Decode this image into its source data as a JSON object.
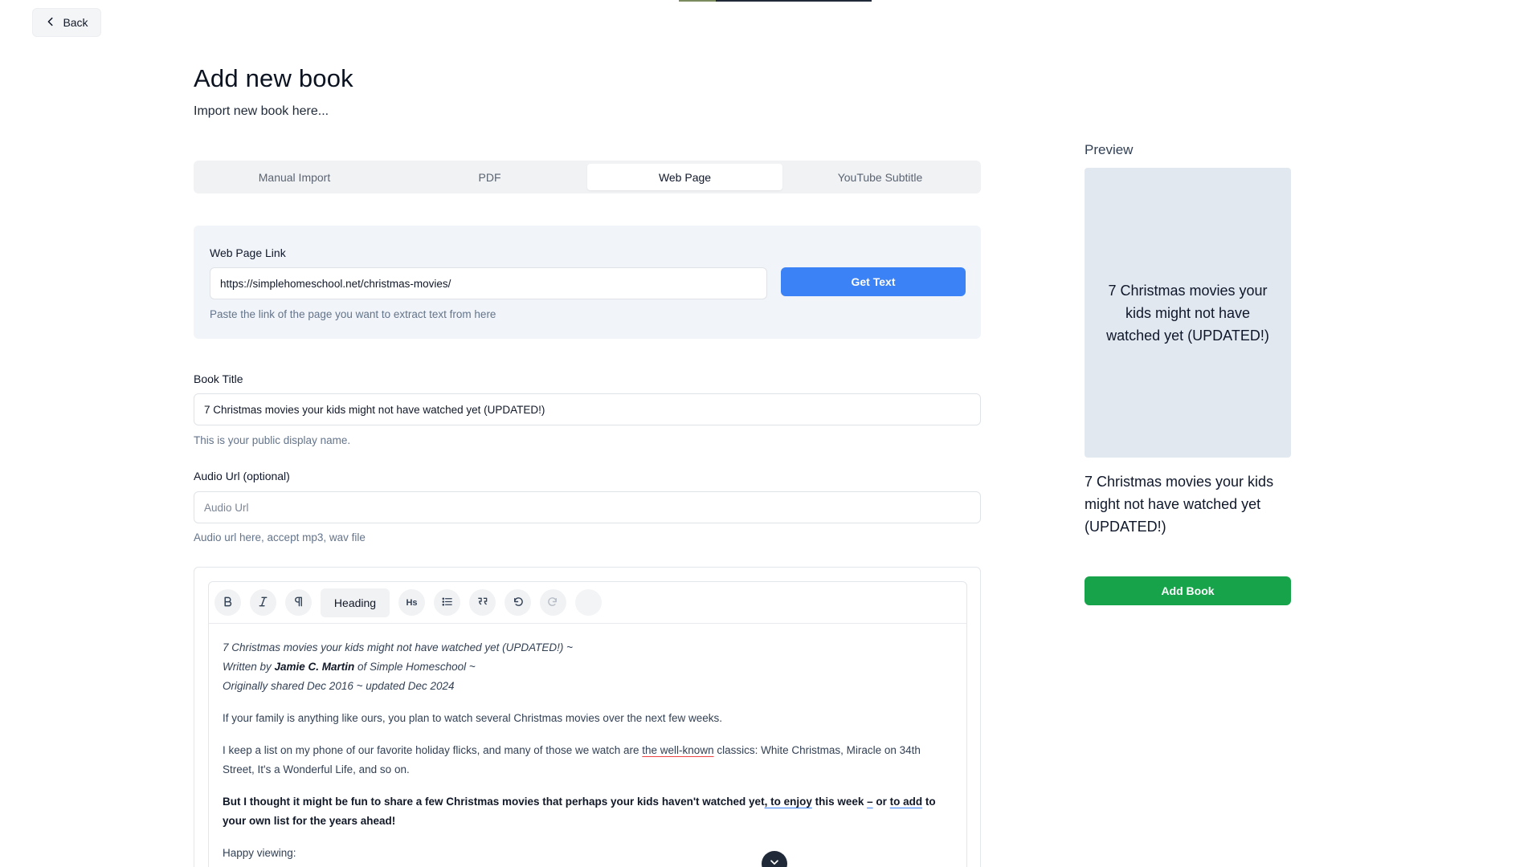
{
  "nav": {
    "back_label": "Back",
    "back_icon": "chevron-left-icon"
  },
  "page": {
    "title": "Add new book",
    "subtitle": "Import new book here..."
  },
  "tabs": [
    {
      "label": "Manual Import",
      "active": false
    },
    {
      "label": "PDF",
      "active": false
    },
    {
      "label": "Web Page",
      "active": true
    },
    {
      "label": "YouTube Subtitle",
      "active": false
    }
  ],
  "web_link": {
    "label": "Web Page Link",
    "value": "https://simplehomeschool.net/christmas-movies/",
    "button_label": "Get Text",
    "help": "Paste the link of the page you want to extract text from here"
  },
  "book_title": {
    "label": "Book Title",
    "value": "7 Christmas movies your kids might not have watched yet (UPDATED!)",
    "help": "This is your public display name."
  },
  "audio_url": {
    "label": "Audio Url (optional)",
    "placeholder": "Audio Url",
    "help": "Audio url here, accept mp3, wav file"
  },
  "editor": {
    "toolbar": {
      "bold_icon": "bold-icon",
      "italic_icon": "italic-icon",
      "paragraph_icon": "paragraph-icon",
      "heading_label": "Heading",
      "hs_label": "Hs",
      "list_icon": "bullet-list-icon",
      "quote_icon": "quote-icon",
      "undo_icon": "undo-icon",
      "redo_icon": "redo-icon"
    },
    "content": {
      "meta_line1": "7 Christmas movies your kids might not have watched yet (UPDATED!) ~",
      "meta_line2_pre": "Written by ",
      "meta_line2_author": "Jamie C. Martin",
      "meta_line2_post": " of Simple Homeschool ~",
      "meta_line3": "Originally shared Dec 2016 ~ updated Dec 2024",
      "para1": "If your family is anything like ours, you plan to watch several Christmas movies over the next few weeks.",
      "para2_pre": "I keep a list on my phone of our favorite holiday flicks, and many of those we watch are ",
      "para2_underlined": "the well-known",
      "para2_post": " classics: White Christmas, Miracle on 34th Street, It's a Wonderful Life, and so on.",
      "para3_a": "But I thought it might be fun to share a few Christmas movies that perhaps your kids haven't watched yet",
      "para3_b": ", to enjoy",
      "para3_c": " this week ",
      "para3_d": "–",
      "para3_e": " or ",
      "para3_f": "to add",
      "para3_g": " to your own list for the years ahead!",
      "para4": "Happy viewing:"
    }
  },
  "preview": {
    "label": "Preview",
    "cover_text": "7 Christmas movies your kids might not have watched yet (UPDATED!)",
    "title": "7 Christmas movies your kids might not have watched yet (UPDATED!)",
    "add_button_label": "Add Book"
  },
  "colors": {
    "accent_blue": "#3b82f6",
    "accent_green": "#16a34a",
    "card_bg": "#f1f5f9",
    "cover_bg": "#e2e8f0"
  }
}
